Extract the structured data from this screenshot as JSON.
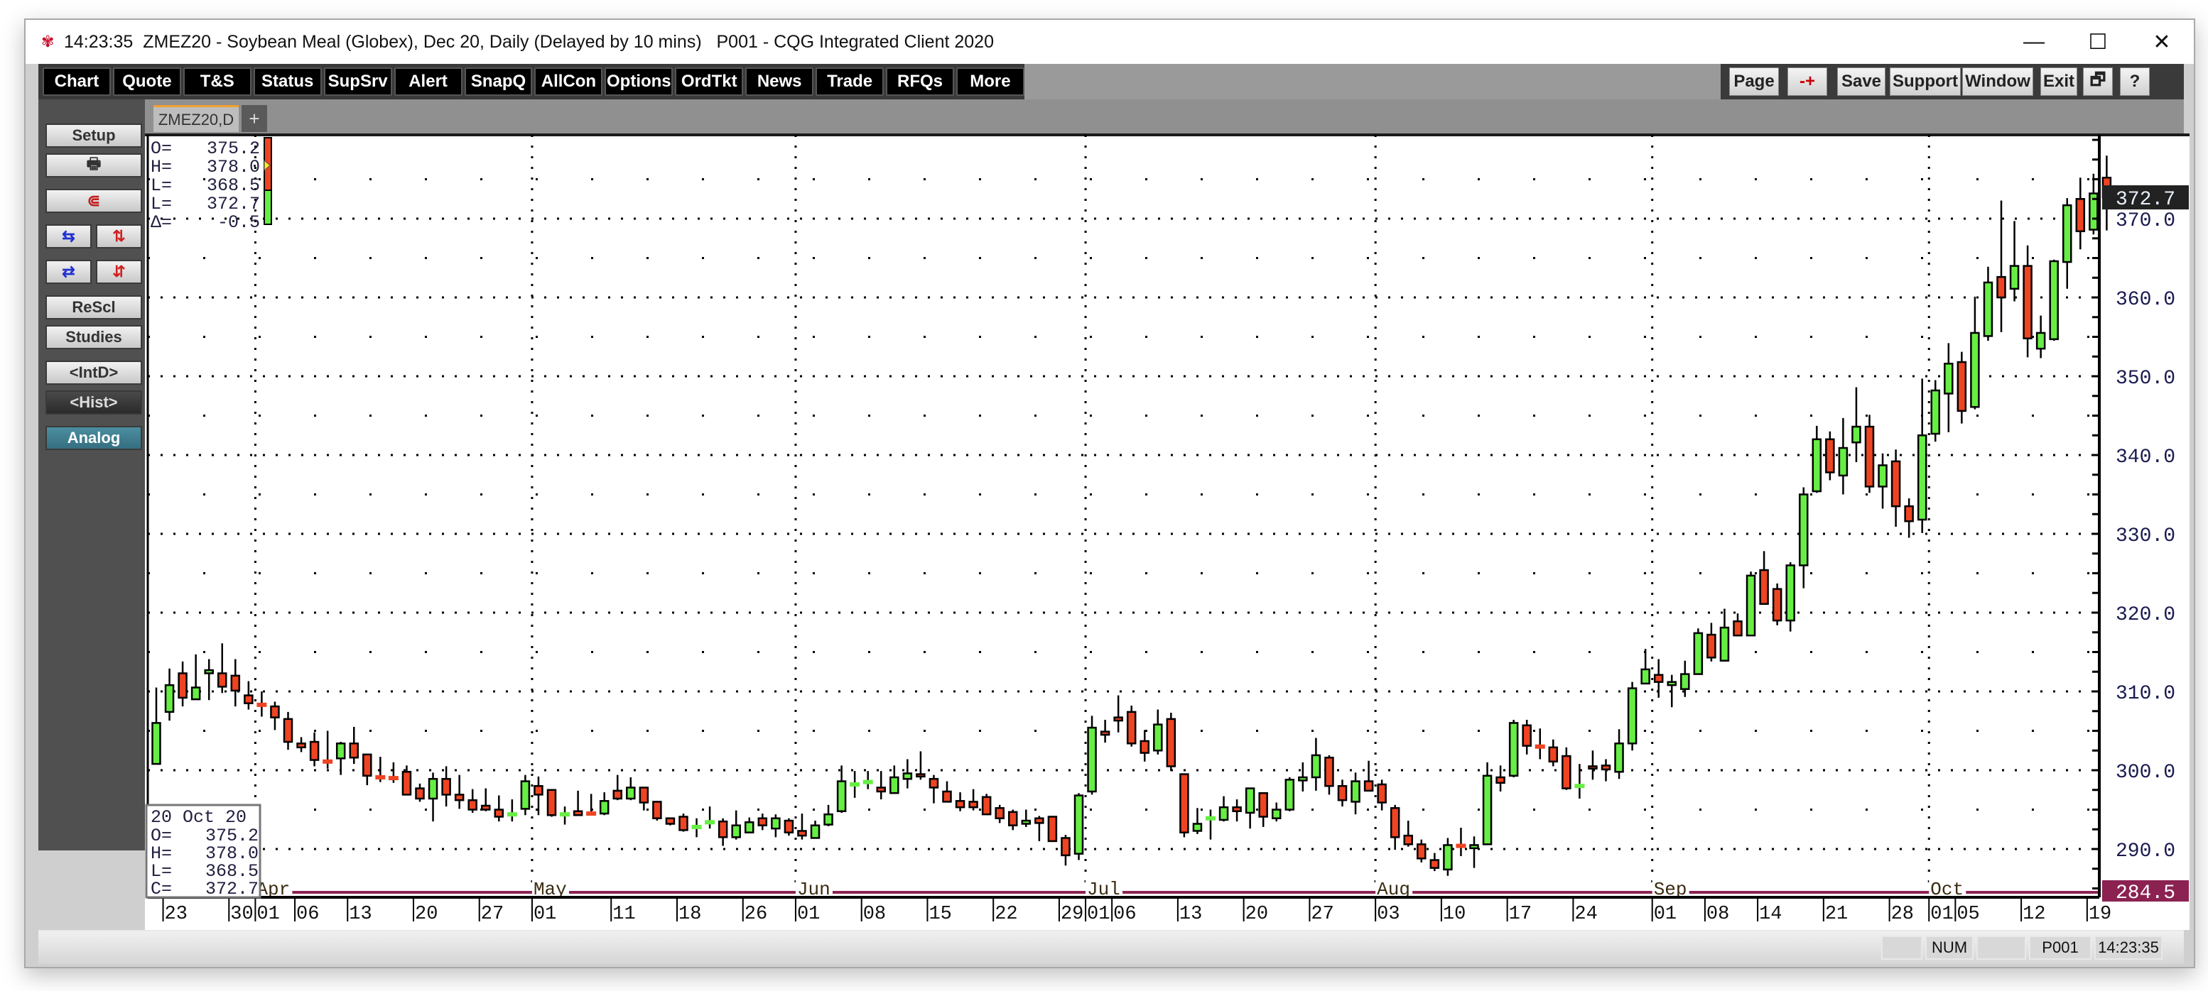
{
  "window": {
    "time": "14:23:35",
    "title": "ZMEZ20 - Soybean Meal (Globex), Dec 20, Daily (Delayed by 10 mins)   P001 - CQG Integrated Client 2020",
    "controls": {
      "minimize": "—",
      "maximize": "☐",
      "close": "✕"
    }
  },
  "toolbar": {
    "left": [
      "Chart",
      "Quote",
      "T&S",
      "Status",
      "SupSrv",
      "Alert",
      "SnapQ",
      "AllCon",
      "Options",
      "OrdTkt",
      "News",
      "Trade",
      "RFQs",
      "More"
    ],
    "right": {
      "page": "Page",
      "zoom": "-+",
      "save": "Save",
      "support": "Support",
      "window": "Window",
      "exit": "Exit",
      "restore": "🗗",
      "help": "?"
    }
  },
  "tabs": {
    "active": "ZMEZ20,D",
    "add": "+"
  },
  "sidebar": {
    "setup": "Setup",
    "print_icon": "printer-icon",
    "magnet_icon": "magnet-icon",
    "rescale": "ReScl",
    "studies": "Studies",
    "intraday": "<IntD>",
    "history": "<Hist>",
    "analog": "Analog"
  },
  "quote_box": {
    "lines": [
      {
        "label": "O=",
        "value": "375.2"
      },
      {
        "label": "H=",
        "value": "378.0"
      },
      {
        "label": "L=",
        "value": "368.5"
      },
      {
        "label": "L=",
        "value": "372.7"
      },
      {
        "label": "Δ=",
        "value": "-0.5"
      }
    ]
  },
  "cursor_box": {
    "date": "20 Oct 20",
    "lines": [
      {
        "label": "O=",
        "value": "375.2"
      },
      {
        "label": "H=",
        "value": "378.0"
      },
      {
        "label": "L=",
        "value": "368.5"
      },
      {
        "label": "C=",
        "value": "372.7"
      }
    ]
  },
  "statusbar": {
    "num": "NUM",
    "page": "P001",
    "time": "14:23:35"
  },
  "colors": {
    "up": "#66ee44",
    "down": "#ee4422",
    "last_price_bg": "#222222",
    "low_line": "#8b2252",
    "analog": "#3f7f91"
  },
  "chart_data": {
    "type": "candlestick",
    "symbol": "ZMEZ20",
    "ylim": [
      284.0,
      380.6
    ],
    "yticks": [
      "290.0",
      "300.0",
      "310.0",
      "320.0",
      "330.0",
      "340.0",
      "350.0",
      "360.0",
      "370.0"
    ],
    "last_price": "372.7",
    "low_line": "284.5",
    "grid": true,
    "months": [
      {
        "label": "Apr",
        "date": "04-01"
      },
      {
        "label": "May",
        "date": "05-01"
      },
      {
        "label": "Jun",
        "date": "06-01"
      },
      {
        "label": "Jul",
        "date": "07-01"
      },
      {
        "label": "Aug",
        "date": "08-03"
      },
      {
        "label": "Sep",
        "date": "09-01"
      },
      {
        "label": "Oct",
        "date": "10-01"
      }
    ],
    "xticks": [
      {
        "label": "23",
        "date": "03-23"
      },
      {
        "label": "30",
        "date": "03-30"
      },
      {
        "label": "01",
        "date": "04-01"
      },
      {
        "label": "06",
        "date": "04-06"
      },
      {
        "label": "13",
        "date": "04-13"
      },
      {
        "label": "20",
        "date": "04-20"
      },
      {
        "label": "27",
        "date": "04-27"
      },
      {
        "label": "01",
        "date": "05-01"
      },
      {
        "label": "11",
        "date": "05-11"
      },
      {
        "label": "18",
        "date": "05-18"
      },
      {
        "label": "26",
        "date": "05-26"
      },
      {
        "label": "01",
        "date": "06-01"
      },
      {
        "label": "08",
        "date": "06-08"
      },
      {
        "label": "15",
        "date": "06-15"
      },
      {
        "label": "22",
        "date": "06-22"
      },
      {
        "label": "29",
        "date": "06-29"
      },
      {
        "label": "01",
        "date": "07-01"
      },
      {
        "label": "06",
        "date": "07-06"
      },
      {
        "label": "13",
        "date": "07-13"
      },
      {
        "label": "20",
        "date": "07-20"
      },
      {
        "label": "27",
        "date": "07-27"
      },
      {
        "label": "03",
        "date": "08-03"
      },
      {
        "label": "10",
        "date": "08-10"
      },
      {
        "label": "17",
        "date": "08-17"
      },
      {
        "label": "24",
        "date": "08-24"
      },
      {
        "label": "01",
        "date": "09-01"
      },
      {
        "label": "08",
        "date": "09-08"
      },
      {
        "label": "14",
        "date": "09-14"
      },
      {
        "label": "21",
        "date": "09-21"
      },
      {
        "label": "28",
        "date": "09-28"
      },
      {
        "label": "01",
        "date": "10-01"
      },
      {
        "label": "05",
        "date": "10-05"
      },
      {
        "label": "12",
        "date": "10-12"
      },
      {
        "label": "19",
        "date": "10-19"
      }
    ],
    "columns": [
      "date",
      "open",
      "high",
      "low",
      "close"
    ],
    "candles": [
      [
        "03-20",
        300.8,
        310.5,
        300.8,
        306.0
      ],
      [
        "03-23",
        307.4,
        312.9,
        306.3,
        310.8
      ],
      [
        "03-24",
        312.3,
        313.8,
        308.1,
        309.2
      ],
      [
        "03-25",
        309.0,
        314.7,
        309.0,
        310.5
      ],
      [
        "03-26",
        312.3,
        314.1,
        308.9,
        312.7
      ],
      [
        "03-27",
        312.3,
        316.1,
        309.8,
        310.6
      ],
      [
        "03-30",
        312.0,
        314.1,
        308.1,
        310.1
      ],
      [
        "03-31",
        309.5,
        311.3,
        307.7,
        308.5
      ],
      [
        "04-01",
        308.5,
        310.0,
        306.8,
        308.3
      ],
      [
        "04-02",
        308.1,
        308.7,
        305.1,
        306.7
      ],
      [
        "04-03",
        306.5,
        307.4,
        302.6,
        303.6
      ],
      [
        "04-06",
        303.4,
        304.2,
        302.3,
        302.9
      ],
      [
        "04-07",
        303.6,
        304.8,
        300.5,
        301.3
      ],
      [
        "04-08",
        301.3,
        305.0,
        300.2,
        301.1
      ],
      [
        "04-09",
        301.5,
        303.6,
        299.4,
        303.4
      ],
      [
        "04-13",
        303.4,
        305.5,
        300.8,
        301.6
      ],
      [
        "04-14",
        302.0,
        302.0,
        298.1,
        299.3
      ],
      [
        "04-15",
        299.2,
        301.7,
        298.5,
        299.1
      ],
      [
        "04-16",
        299.1,
        301.0,
        298.4,
        299.0
      ],
      [
        "04-17",
        299.8,
        300.6,
        296.9,
        296.9
      ],
      [
        "04-20",
        297.7,
        298.3,
        296.0,
        296.4
      ],
      [
        "04-21",
        296.4,
        299.7,
        293.5,
        298.9
      ],
      [
        "04-22",
        298.9,
        300.5,
        295.4,
        296.9
      ],
      [
        "04-23",
        296.9,
        299.4,
        295.1,
        296.2
      ],
      [
        "04-24",
        296.2,
        297.6,
        294.6,
        295.0
      ],
      [
        "04-27",
        295.5,
        297.7,
        294.8,
        295.0
      ],
      [
        "04-28",
        295.0,
        296.8,
        293.5,
        294.1
      ],
      [
        "04-29",
        294.2,
        296.3,
        293.5,
        294.4
      ],
      [
        "04-30",
        295.1,
        299.4,
        294.3,
        298.6
      ],
      [
        "05-01",
        298.0,
        299.2,
        294.3,
        296.9
      ],
      [
        "05-04",
        297.5,
        297.5,
        294.1,
        294.3
      ],
      [
        "05-05",
        294.2,
        295.4,
        293.1,
        294.4
      ],
      [
        "05-06",
        294.8,
        297.4,
        294.3,
        294.3
      ],
      [
        "05-07",
        294.6,
        297.0,
        294.3,
        294.5
      ],
      [
        "05-08",
        294.5,
        297.2,
        294.3,
        296.1
      ],
      [
        "05-11",
        297.4,
        299.4,
        296.2,
        296.4
      ],
      [
        "05-12",
        296.4,
        299.1,
        296.2,
        297.8
      ],
      [
        "05-13",
        297.8,
        297.8,
        294.9,
        295.9
      ],
      [
        "05-14",
        296.0,
        296.0,
        293.6,
        293.9
      ],
      [
        "05-15",
        293.9,
        293.9,
        293.0,
        293.2
      ],
      [
        "05-18",
        294.1,
        294.5,
        292.2,
        292.4
      ],
      [
        "05-19",
        292.8,
        293.9,
        291.5,
        292.8
      ],
      [
        "05-20",
        293.2,
        295.4,
        292.6,
        293.4
      ],
      [
        "05-21",
        293.5,
        293.9,
        290.4,
        291.5
      ],
      [
        "05-22",
        291.5,
        294.9,
        291.2,
        293.0
      ],
      [
        "05-26",
        292.1,
        294.0,
        292.1,
        293.4
      ],
      [
        "05-27",
        293.9,
        294.5,
        292.4,
        293.0
      ],
      [
        "05-28",
        292.6,
        294.4,
        291.5,
        293.9
      ],
      [
        "05-29",
        293.6,
        293.9,
        291.7,
        292.1
      ],
      [
        "06-01",
        292.3,
        294.5,
        291.2,
        291.7
      ],
      [
        "06-02",
        291.4,
        293.6,
        291.4,
        293.0
      ],
      [
        "06-03",
        293.1,
        295.6,
        292.9,
        294.4
      ],
      [
        "06-04",
        294.8,
        300.6,
        294.6,
        298.6
      ],
      [
        "06-05",
        298.2,
        299.9,
        296.5,
        298.2
      ],
      [
        "06-08",
        298.4,
        299.9,
        297.6,
        298.5
      ],
      [
        "06-09",
        297.8,
        299.9,
        296.3,
        297.3
      ],
      [
        "06-10",
        297.1,
        300.6,
        297.0,
        299.1
      ],
      [
        "06-11",
        298.9,
        301.4,
        297.7,
        299.6
      ],
      [
        "06-12",
        299.5,
        302.4,
        298.8,
        299.2
      ],
      [
        "06-15",
        298.9,
        299.4,
        295.8,
        297.8
      ],
      [
        "06-16",
        297.3,
        298.6,
        296.0,
        296.0
      ],
      [
        "06-17",
        296.1,
        297.2,
        294.8,
        295.3
      ],
      [
        "06-18",
        296.0,
        297.6,
        294.9,
        295.3
      ],
      [
        "06-19",
        296.6,
        297.0,
        294.4,
        294.4
      ],
      [
        "06-22",
        295.2,
        295.6,
        293.3,
        293.9
      ],
      [
        "06-23",
        294.7,
        295.0,
        292.4,
        293.0
      ],
      [
        "06-24",
        293.2,
        295.0,
        292.8,
        293.6
      ],
      [
        "06-25",
        293.9,
        294.2,
        291.0,
        293.3
      ],
      [
        "06-26",
        294.1,
        294.2,
        291.0,
        291.0
      ],
      [
        "06-29",
        291.4,
        291.8,
        287.9,
        289.2
      ],
      [
        "06-30",
        289.4,
        297.1,
        288.6,
        296.8
      ],
      [
        "07-01",
        297.3,
        306.9,
        296.9,
        305.4
      ],
      [
        "07-02",
        304.9,
        306.4,
        303.5,
        304.5
      ],
      [
        "07-06",
        306.7,
        309.5,
        304.8,
        306.3
      ],
      [
        "07-07",
        307.4,
        308.2,
        303.0,
        303.4
      ],
      [
        "07-08",
        303.7,
        305.1,
        301.1,
        302.2
      ],
      [
        "07-09",
        302.5,
        307.7,
        302.0,
        305.8
      ],
      [
        "07-10",
        306.5,
        307.3,
        299.9,
        300.5
      ],
      [
        "07-13",
        299.5,
        299.5,
        291.5,
        292.1
      ],
      [
        "07-14",
        292.3,
        295.2,
        291.9,
        293.2
      ],
      [
        "07-15",
        293.7,
        295.0,
        291.2,
        293.9
      ],
      [
        "07-16",
        293.7,
        296.7,
        293.5,
        295.3
      ],
      [
        "07-17",
        295.3,
        296.3,
        293.5,
        294.8
      ],
      [
        "07-20",
        294.6,
        297.7,
        292.6,
        297.7
      ],
      [
        "07-21",
        297.1,
        297.1,
        292.8,
        294.1
      ],
      [
        "07-22",
        293.9,
        295.9,
        293.5,
        295.0
      ],
      [
        "07-23",
        295.0,
        299.1,
        294.8,
        298.8
      ],
      [
        "07-24",
        298.7,
        301.0,
        297.3,
        299.1
      ],
      [
        "07-27",
        299.1,
        304.1,
        297.4,
        301.9
      ],
      [
        "07-28",
        301.6,
        301.9,
        296.9,
        298.0
      ],
      [
        "07-29",
        298.0,
        298.8,
        295.4,
        296.2
      ],
      [
        "07-30",
        296.0,
        299.7,
        294.4,
        298.6
      ],
      [
        "07-31",
        298.6,
        301.2,
        297.3,
        297.4
      ],
      [
        "08-03",
        298.2,
        298.8,
        294.9,
        295.9
      ],
      [
        "08-04",
        295.2,
        295.6,
        289.9,
        291.5
      ],
      [
        "08-05",
        291.7,
        293.6,
        290.3,
        290.6
      ],
      [
        "08-06",
        290.6,
        291.2,
        288.3,
        288.8
      ],
      [
        "08-07",
        288.6,
        289.5,
        287.2,
        287.6
      ],
      [
        "08-10",
        287.4,
        291.4,
        286.6,
        290.5
      ],
      [
        "08-11",
        290.5,
        292.7,
        289.1,
        290.4
      ],
      [
        "08-12",
        290.1,
        291.6,
        287.6,
        290.5
      ],
      [
        "08-13",
        290.6,
        301.0,
        290.5,
        299.3
      ],
      [
        "08-14",
        299.1,
        300.6,
        297.3,
        298.4
      ],
      [
        "08-17",
        299.3,
        306.4,
        299.1,
        306.0
      ],
      [
        "08-18",
        305.7,
        306.4,
        302.0,
        303.1
      ],
      [
        "08-19",
        303.1,
        305.3,
        301.4,
        303.0
      ],
      [
        "08-20",
        302.9,
        303.9,
        300.5,
        301.1
      ],
      [
        "08-21",
        301.8,
        302.9,
        297.5,
        297.7
      ],
      [
        "08-24",
        297.9,
        300.8,
        296.4,
        298.0
      ],
      [
        "08-25",
        300.5,
        302.5,
        298.8,
        300.2
      ],
      [
        "08-26",
        300.6,
        301.4,
        298.6,
        300.1
      ],
      [
        "08-27",
        299.8,
        305.2,
        298.9,
        303.4
      ],
      [
        "08-28",
        303.4,
        311.2,
        302.5,
        310.4
      ],
      [
        "08-31",
        311.0,
        315.4,
        311.0,
        312.8
      ],
      [
        "09-01",
        312.1,
        314.1,
        309.2,
        311.2
      ],
      [
        "09-02",
        310.8,
        312.1,
        308.0,
        311.2
      ],
      [
        "09-03",
        310.3,
        313.9,
        309.3,
        312.2
      ],
      [
        "09-04",
        312.2,
        318.0,
        312.2,
        317.4
      ],
      [
        "09-08",
        317.2,
        318.7,
        313.8,
        314.3
      ],
      [
        "09-09",
        313.9,
        320.5,
        313.8,
        318.1
      ],
      [
        "09-10",
        318.9,
        319.9,
        317.0,
        317.1
      ],
      [
        "09-11",
        317.1,
        325.2,
        317.1,
        324.7
      ],
      [
        "09-14",
        325.4,
        327.8,
        321.0,
        321.1
      ],
      [
        "09-15",
        323.0,
        323.7,
        318.4,
        319.0
      ],
      [
        "09-16",
        319.0,
        326.4,
        317.6,
        326.0
      ],
      [
        "09-17",
        326.0,
        335.9,
        323.1,
        335.0
      ],
      [
        "09-18",
        335.4,
        343.7,
        335.2,
        342.0
      ],
      [
        "09-21",
        342.0,
        343.0,
        336.8,
        337.8
      ],
      [
        "09-22",
        337.4,
        344.7,
        335.0,
        340.9
      ],
      [
        "09-23",
        341.6,
        348.6,
        339.1,
        343.6
      ],
      [
        "09-24",
        343.6,
        345.1,
        335.2,
        336.0
      ],
      [
        "09-25",
        336.0,
        340.2,
        333.2,
        338.7
      ],
      [
        "09-28",
        339.2,
        340.7,
        330.9,
        333.5
      ],
      [
        "09-29",
        333.5,
        334.5,
        329.5,
        331.6
      ],
      [
        "09-30",
        331.8,
        349.7,
        330.1,
        342.5
      ],
      [
        "10-01",
        342.7,
        349.5,
        341.7,
        348.2
      ],
      [
        "10-02",
        347.8,
        354.2,
        342.9,
        351.6
      ],
      [
        "10-05",
        351.8,
        353.1,
        344.0,
        345.6
      ],
      [
        "10-06",
        346.1,
        360.1,
        345.8,
        355.5
      ],
      [
        "10-07",
        355.1,
        363.9,
        354.5,
        361.9
      ],
      [
        "10-08",
        362.6,
        372.3,
        355.6,
        360.0
      ],
      [
        "10-09",
        361.1,
        369.7,
        359.5,
        364.0
      ],
      [
        "10-12",
        364.0,
        366.6,
        352.4,
        354.8
      ],
      [
        "10-13",
        353.5,
        357.7,
        352.3,
        355.5
      ],
      [
        "10-14",
        354.7,
        364.8,
        354.5,
        364.6
      ],
      [
        "10-15",
        364.5,
        372.6,
        361.1,
        371.7
      ],
      [
        "10-16",
        372.5,
        375.2,
        366.1,
        368.4
      ],
      [
        "10-19",
        368.6,
        375.7,
        368.0,
        373.2
      ],
      [
        "10-20",
        375.2,
        378.0,
        368.5,
        372.7
      ]
    ]
  }
}
